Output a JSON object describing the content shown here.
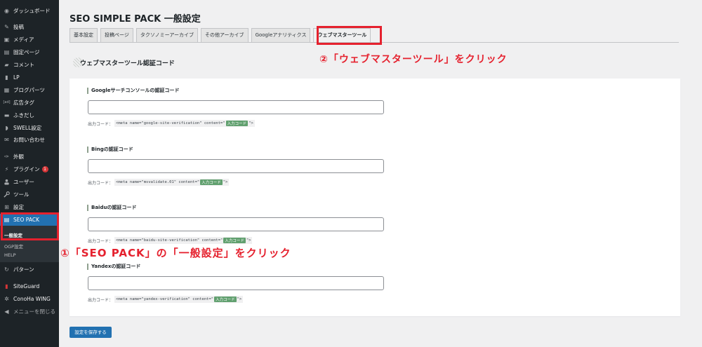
{
  "sidebar": {
    "items": [
      {
        "label": "ダッシュボード",
        "icon": "dashboard-icon",
        "glyph": "◉"
      },
      {
        "label": "投稿",
        "icon": "pin-icon",
        "glyph": "✎"
      },
      {
        "label": "メディア",
        "icon": "media-icon",
        "glyph": "▣"
      },
      {
        "label": "固定ページ",
        "icon": "page-icon",
        "glyph": "▤"
      },
      {
        "label": "コメント",
        "icon": "comment-icon",
        "glyph": "▰"
      },
      {
        "label": "LP",
        "icon": "lp-icon",
        "glyph": "▮"
      },
      {
        "label": "ブログパーツ",
        "icon": "blog-parts-icon",
        "glyph": "▦"
      },
      {
        "label": "広告タグ",
        "icon": "ad-tag-icon",
        "glyph": "[ad]"
      },
      {
        "label": "ふきだし",
        "icon": "balloon-icon",
        "glyph": "▬"
      },
      {
        "label": "SWELL設定",
        "icon": "swell-icon",
        "glyph": "◗"
      },
      {
        "label": "お問い合わせ",
        "icon": "mail-icon",
        "glyph": "✉"
      },
      {
        "label": "外観",
        "icon": "appearance-icon",
        "glyph": "✑"
      },
      {
        "label": "プラグイン",
        "icon": "plugin-icon",
        "glyph": "⚡",
        "badge": "1"
      },
      {
        "label": "ユーザー",
        "icon": "user-icon",
        "glyph": "👤"
      },
      {
        "label": "ツール",
        "icon": "tool-icon",
        "glyph": "🔧"
      },
      {
        "label": "設定",
        "icon": "settings-icon",
        "glyph": "⊞"
      },
      {
        "label": "SEO PACK",
        "icon": "seo-pack-icon",
        "glyph": "▤"
      },
      {
        "label": "パターン",
        "icon": "pattern-icon",
        "glyph": "↻"
      },
      {
        "label": "SiteGuard",
        "icon": "siteguard-icon",
        "glyph": "▮"
      },
      {
        "label": "ConoHa WING",
        "icon": "conoha-icon",
        "glyph": "✲"
      },
      {
        "label": "メニューを閉じる",
        "icon": "collapse-icon",
        "glyph": "◀"
      }
    ],
    "submenu": [
      "一般設定",
      "OGP設定",
      "HELP"
    ]
  },
  "page": {
    "title": "SEO SIMPLE PACK 一般設定",
    "tabs": [
      "基本設定",
      "投稿ページ",
      "タクソノミーアーカイブ",
      "その他アーカイブ",
      "Googleアナリティクス",
      "ウェブマスターツール"
    ],
    "section_title": "ウェブマスターツール認証コード",
    "output_label": "出力コード：",
    "input_tag": "入力コード",
    "fields": [
      {
        "label": "Googleサーチコンソールの認証コード",
        "value": "",
        "code_before": "<meta name=\"google-site-verification\" content=\"",
        "code_after": "\">"
      },
      {
        "label": "Bingの認証コード",
        "value": "",
        "code_before": "<meta name=\"msvalidate.01\" content=\"",
        "code_after": "\">"
      },
      {
        "label": "Baiduの認証コード",
        "value": "",
        "code_before": "<meta name=\"baidu-site-verification\" content=\"",
        "code_after": "\">"
      },
      {
        "label": "Yandexの認証コード",
        "value": "",
        "code_before": "<meta name=\"yandex-verification\" content=\"",
        "code_after": "\">"
      }
    ],
    "save_label": "設定を保存する"
  },
  "annotations": {
    "step1": "①「SEO PACK」の「一般設定」をクリック",
    "step2": "②「ウェブマスターツール」をクリック"
  },
  "colors": {
    "sidebar_bg": "#1d2327",
    "accent": "#2271b1",
    "annotation": "#e5212e",
    "code_tag": "#61a06f"
  }
}
